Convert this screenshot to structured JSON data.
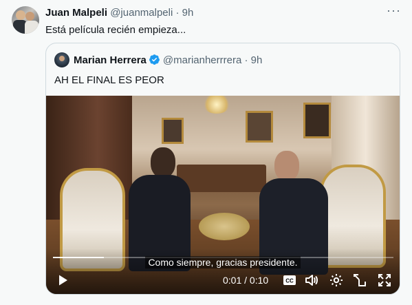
{
  "tweet": {
    "author_name": "Juan Malpeli",
    "handle": "@juanmalpeli",
    "separator": "·",
    "time": "9h",
    "more": "···",
    "text": "Está película recién empieza..."
  },
  "quoted": {
    "author_name": "Marian Herrera",
    "handle": "@marianherrrera",
    "separator": "·",
    "time": "9h",
    "verified": true,
    "text": "AH EL FINAL ES PEOR"
  },
  "video": {
    "subtitle": "Como siempre, gracias presidente.",
    "current_time": "0:01",
    "duration": "0:10",
    "time_display": "0:01 / 0:10",
    "progress_fraction": 0.15,
    "icons": [
      "play-icon",
      "closed-captions-icon",
      "volume-icon",
      "settings-gear-icon",
      "popout-icon",
      "fullscreen-icon"
    ]
  },
  "colors": {
    "background": "#f7f9f9",
    "text": "#0f1419",
    "muted": "#536471",
    "border": "#cfd9de",
    "verified": "#1d9bf0"
  }
}
